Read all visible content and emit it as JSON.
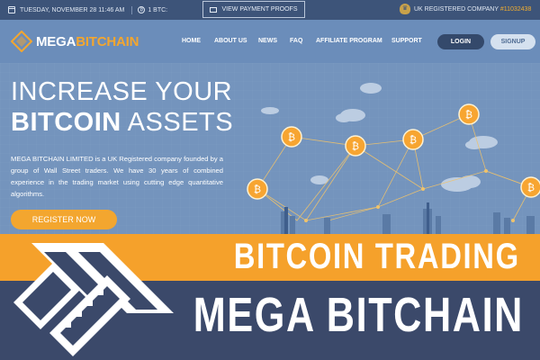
{
  "topbar": {
    "date": "TUESDAY, NOVEMBER 28 11:46 AM",
    "btc_label": "1 BTC:",
    "proofs_button": "VIEW PAYMENT PROOFS",
    "uk_prefix": "UK REGISTERED COMPANY",
    "company_number": "#11032438"
  },
  "logo": {
    "part1": "MEGA",
    "part2": "BITCHAIN"
  },
  "nav": {
    "items": [
      "HOME",
      "ABOUT US",
      "NEWS",
      "FAQ",
      "AFFILIATE PROGRAM",
      "SUPPORT"
    ],
    "login": "LOGIN",
    "signup": "SIGNUP"
  },
  "hero": {
    "line1": "INCREASE YOUR",
    "line2_bold": "BITCOIN",
    "line2_rest": " ASSETS",
    "description": "MEGA BITCHAIN LIMITED is a UK Registered company founded by a group of Wall Street traders. We have 30 years of combined experience in the trading market using cutting edge quantitative algorithms.",
    "register_button": "REGISTER NOW",
    "coin_symbol": "₿"
  },
  "banner": {
    "line1": "BITCOIN TRADING",
    "line2": "MEGA BITCHAIN"
  },
  "colors": {
    "accent": "#f3a62f",
    "dark_navy": "#3b496a",
    "hero_blue": "#7494bd"
  }
}
